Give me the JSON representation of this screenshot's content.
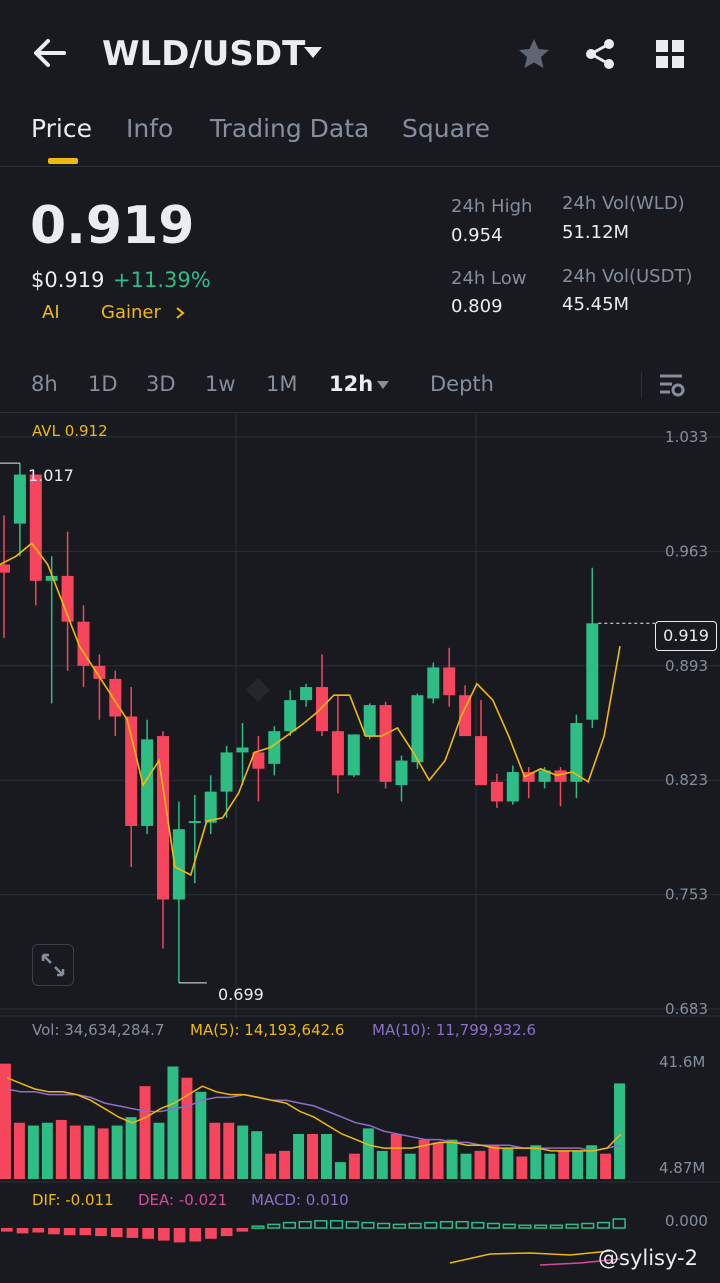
{
  "header": {
    "pair": "WLD/USDT",
    "icons": [
      "back-arrow-icon",
      "caret-down-icon",
      "star-icon",
      "share-icon",
      "grid-icon"
    ]
  },
  "tabs": [
    {
      "label": "Price",
      "active": true
    },
    {
      "label": "Info",
      "active": false
    },
    {
      "label": "Trading Data",
      "active": false
    },
    {
      "label": "Square",
      "active": false
    }
  ],
  "ticker": {
    "last_price": "0.919",
    "usd_price": "$0.919",
    "change": "+11.39%",
    "tags": [
      "AI",
      "Gainer"
    ],
    "stats": {
      "high_label": "24h High",
      "high_value": "0.954",
      "low_label": "24h Low",
      "low_value": "0.809",
      "vol_base_label": "24h Vol(WLD)",
      "vol_base_value": "51.12M",
      "vol_quote_label": "24h Vol(USDT)",
      "vol_quote_value": "45.45M"
    }
  },
  "intervals": {
    "items": [
      "8h",
      "1D",
      "3D",
      "1w",
      "1M",
      "12h",
      "Depth"
    ],
    "selected": "12h"
  },
  "colors": {
    "up": "#2ebd85",
    "down": "#f6465d",
    "accent": "#f0b90b",
    "bg": "#181a20"
  },
  "chart_data": [
    {
      "type": "candlestick",
      "title": "",
      "avl_label": "AVL 0.912",
      "ylim": [
        0.683,
        1.033
      ],
      "y_ticks": [
        "1.033",
        "0.963",
        "0.893",
        "0.823",
        "0.753",
        "0.683"
      ],
      "last_price_tag": "0.919",
      "max_label": "1.017",
      "min_label": "0.699",
      "candles": [
        {
          "o": 0.955,
          "h": 0.985,
          "l": 0.91,
          "c": 0.95
        },
        {
          "o": 0.98,
          "h": 1.017,
          "l": 0.96,
          "c": 1.01
        },
        {
          "o": 1.01,
          "h": 1.01,
          "l": 0.93,
          "c": 0.945
        },
        {
          "o": 0.945,
          "h": 0.96,
          "l": 0.87,
          "c": 0.948
        },
        {
          "o": 0.948,
          "h": 0.975,
          "l": 0.89,
          "c": 0.92
        },
        {
          "o": 0.92,
          "h": 0.93,
          "l": 0.88,
          "c": 0.893
        },
        {
          "o": 0.893,
          "h": 0.9,
          "l": 0.86,
          "c": 0.885
        },
        {
          "o": 0.885,
          "h": 0.89,
          "l": 0.85,
          "c": 0.862
        },
        {
          "o": 0.862,
          "h": 0.88,
          "l": 0.77,
          "c": 0.795
        },
        {
          "o": 0.795,
          "h": 0.86,
          "l": 0.79,
          "c": 0.848
        },
        {
          "o": 0.85,
          "h": 0.853,
          "l": 0.72,
          "c": 0.75
        },
        {
          "o": 0.75,
          "h": 0.81,
          "l": 0.699,
          "c": 0.793
        },
        {
          "o": 0.797,
          "h": 0.814,
          "l": 0.76,
          "c": 0.798
        },
        {
          "o": 0.797,
          "h": 0.826,
          "l": 0.79,
          "c": 0.816
        },
        {
          "o": 0.816,
          "h": 0.844,
          "l": 0.8,
          "c": 0.84
        },
        {
          "o": 0.84,
          "h": 0.858,
          "l": 0.82,
          "c": 0.843
        },
        {
          "o": 0.84,
          "h": 0.85,
          "l": 0.81,
          "c": 0.83
        },
        {
          "o": 0.833,
          "h": 0.856,
          "l": 0.826,
          "c": 0.853
        },
        {
          "o": 0.853,
          "h": 0.878,
          "l": 0.85,
          "c": 0.872
        },
        {
          "o": 0.872,
          "h": 0.882,
          "l": 0.868,
          "c": 0.88
        },
        {
          "o": 0.88,
          "h": 0.9,
          "l": 0.85,
          "c": 0.853
        },
        {
          "o": 0.853,
          "h": 0.875,
          "l": 0.815,
          "c": 0.826
        },
        {
          "o": 0.826,
          "h": 0.851,
          "l": 0.825,
          "c": 0.851
        },
        {
          "o": 0.85,
          "h": 0.87,
          "l": 0.848,
          "c": 0.869
        },
        {
          "o": 0.869,
          "h": 0.871,
          "l": 0.818,
          "c": 0.822
        },
        {
          "o": 0.82,
          "h": 0.838,
          "l": 0.81,
          "c": 0.835
        },
        {
          "o": 0.834,
          "h": 0.876,
          "l": 0.83,
          "c": 0.875
        },
        {
          "o": 0.873,
          "h": 0.895,
          "l": 0.87,
          "c": 0.892
        },
        {
          "o": 0.892,
          "h": 0.904,
          "l": 0.868,
          "c": 0.875
        },
        {
          "o": 0.875,
          "h": 0.881,
          "l": 0.85,
          "c": 0.85
        },
        {
          "o": 0.85,
          "h": 0.872,
          "l": 0.82,
          "c": 0.82
        },
        {
          "o": 0.822,
          "h": 0.827,
          "l": 0.806,
          "c": 0.81
        },
        {
          "o": 0.81,
          "h": 0.832,
          "l": 0.808,
          "c": 0.828
        },
        {
          "o": 0.828,
          "h": 0.831,
          "l": 0.812,
          "c": 0.822
        },
        {
          "o": 0.822,
          "h": 0.831,
          "l": 0.818,
          "c": 0.829
        },
        {
          "o": 0.829,
          "h": 0.831,
          "l": 0.807,
          "c": 0.822
        },
        {
          "o": 0.822,
          "h": 0.863,
          "l": 0.812,
          "c": 0.858
        },
        {
          "o": 0.86,
          "h": 0.953,
          "l": 0.855,
          "c": 0.919
        }
      ],
      "avl_line": [
        0.955,
        0.96,
        0.968,
        0.955,
        0.93,
        0.905,
        0.89,
        0.875,
        0.86,
        0.82,
        0.835,
        0.77,
        0.765,
        0.798,
        0.8,
        0.815,
        0.84,
        0.843,
        0.85,
        0.857,
        0.865,
        0.875,
        0.875,
        0.85,
        0.85,
        0.855,
        0.84,
        0.823,
        0.835,
        0.862,
        0.882,
        0.872,
        0.85,
        0.825,
        0.83,
        0.826,
        0.828,
        0.822,
        0.85,
        0.905
      ]
    },
    {
      "type": "bar",
      "title": "",
      "vol_label": "Vol: 34,634,284.7",
      "ma5_label": "MA(5): 14,193,642.6",
      "ma10_label": "MA(10): 11,799,932.6",
      "y_ticks": [
        "41.6M",
        "4.87M"
      ],
      "ylim": [
        4.87,
        41.6
      ],
      "values": [
        41,
        20,
        19,
        20,
        21,
        19,
        19,
        18,
        19,
        22,
        33,
        20,
        40,
        36,
        31,
        20,
        20,
        19,
        17,
        9,
        10,
        16,
        16,
        16,
        6,
        9,
        18,
        10,
        16,
        9,
        14,
        13,
        14,
        9,
        10,
        12,
        11,
        8,
        12,
        9,
        10,
        10,
        12,
        9,
        34
      ],
      "ma5": [
        36,
        34,
        32,
        31,
        31,
        30,
        28,
        25,
        22,
        20,
        22,
        25,
        27,
        30,
        33,
        31,
        30,
        30,
        29,
        28,
        27,
        24,
        22,
        19,
        16,
        14,
        12,
        11,
        11,
        11,
        12,
        13,
        13,
        12,
        12,
        11,
        11,
        11,
        11,
        10,
        10,
        10,
        10,
        11,
        16
      ],
      "ma10": [
        32,
        31,
        31,
        30,
        30,
        30,
        29,
        27,
        26,
        25,
        24,
        24,
        25,
        26,
        28,
        29,
        29,
        30,
        29,
        28,
        28,
        27,
        26,
        24,
        22,
        20,
        19,
        17,
        16,
        15,
        14,
        14,
        13,
        13,
        12,
        12,
        12,
        11,
        11,
        11,
        11,
        11,
        10,
        11,
        12
      ]
    },
    {
      "type": "bar",
      "title": "",
      "dif_label": "DIF: -0.011",
      "dea_label": "DEA: -0.021",
      "macd_label": "MACD: 0.010",
      "zero_label": "0.000",
      "values": [
        -0.004,
        -0.006,
        -0.005,
        -0.007,
        -0.008,
        -0.008,
        -0.009,
        -0.01,
        -0.011,
        -0.012,
        -0.014,
        -0.016,
        -0.015,
        -0.012,
        -0.009,
        -0.004,
        0.002,
        0.004,
        0.006,
        0.007,
        0.008,
        0.008,
        0.007,
        0.006,
        0.005,
        0.004,
        0.005,
        0.006,
        0.007,
        0.007,
        0.006,
        0.005,
        0.004,
        0.003,
        0.003,
        0.003,
        0.004,
        0.005,
        0.006,
        0.01
      ]
    }
  ],
  "watermark": "@sylisy-2",
  "expand_icon": "expand-icon"
}
